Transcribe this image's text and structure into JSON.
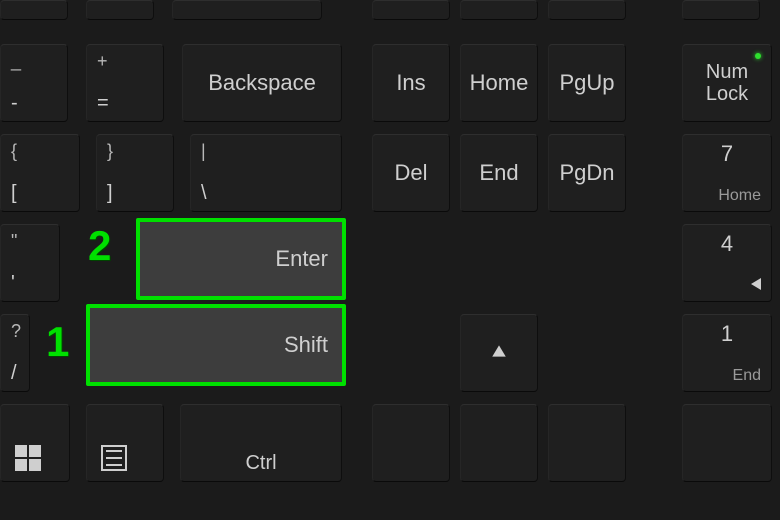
{
  "highlights": {
    "enter_key": true,
    "shift_key": true
  },
  "annotations": {
    "enter_number": "2",
    "shift_number": "1"
  },
  "keys": {
    "minus": {
      "upper": "_",
      "lower": "-"
    },
    "equals": {
      "upper": "+",
      "lower": "="
    },
    "backspace": {
      "label": "Backspace"
    },
    "ins": {
      "label": "Ins"
    },
    "home": {
      "label": "Home"
    },
    "pgup": {
      "label": "PgUp"
    },
    "numlock": {
      "line1": "Num",
      "line2": "Lock"
    },
    "lbracket": {
      "upper": "{",
      "lower": "["
    },
    "rbracket": {
      "upper": "}",
      "lower": "]"
    },
    "backslash": {
      "upper": "|",
      "lower": "\\"
    },
    "del": {
      "label": "Del"
    },
    "end": {
      "label": "End"
    },
    "pgdn": {
      "label": "PgDn"
    },
    "num7": {
      "label": "7",
      "sub": "Home"
    },
    "quote": {
      "upper": "\"",
      "lower": "'"
    },
    "enter": {
      "label": "Enter"
    },
    "num4": {
      "label": "4"
    },
    "slash": {
      "upper": "?",
      "lower": "/"
    },
    "shift": {
      "label": "Shift"
    },
    "num1": {
      "label": "1",
      "sub": "End"
    },
    "ctrl": {
      "label": "Ctrl"
    }
  },
  "indicators": {
    "numlock_led": true
  }
}
